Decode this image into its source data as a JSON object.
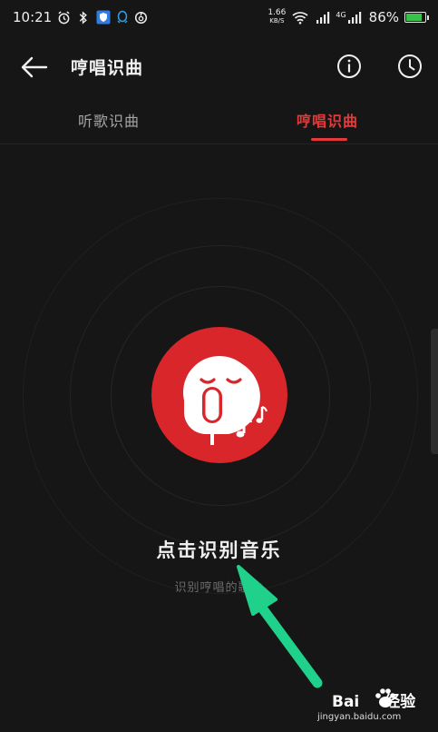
{
  "status_bar": {
    "time": "10:21",
    "net_speed_value": "1.66",
    "net_speed_unit": "KB/S",
    "signal_1_label": "4G",
    "signal_2_label": "4G",
    "battery_percent": "86%",
    "battery_level": 0.86,
    "icons": [
      "alarm-icon",
      "bluetooth-icon",
      "shield-app-icon",
      "qq-icon",
      "netease-music-icon",
      "wifi-icon",
      "signal-icon",
      "battery-icon"
    ]
  },
  "app_bar": {
    "title": "哼唱识曲"
  },
  "tabs": [
    {
      "label": "听歌识曲",
      "active": false
    },
    {
      "label": "哼唱识曲",
      "active": true
    }
  ],
  "colors": {
    "accent": "#e63a3a",
    "button_red": "#d8262a",
    "background": "#161616",
    "arrow": "#1fd18b"
  },
  "main": {
    "primary_label": "点击识别音乐",
    "secondary_label": "识别哼唱的歌曲"
  },
  "watermark": {
    "brand": "Bai",
    "brand_suffix": "经验",
    "url": "jingyan.baidu.com"
  }
}
